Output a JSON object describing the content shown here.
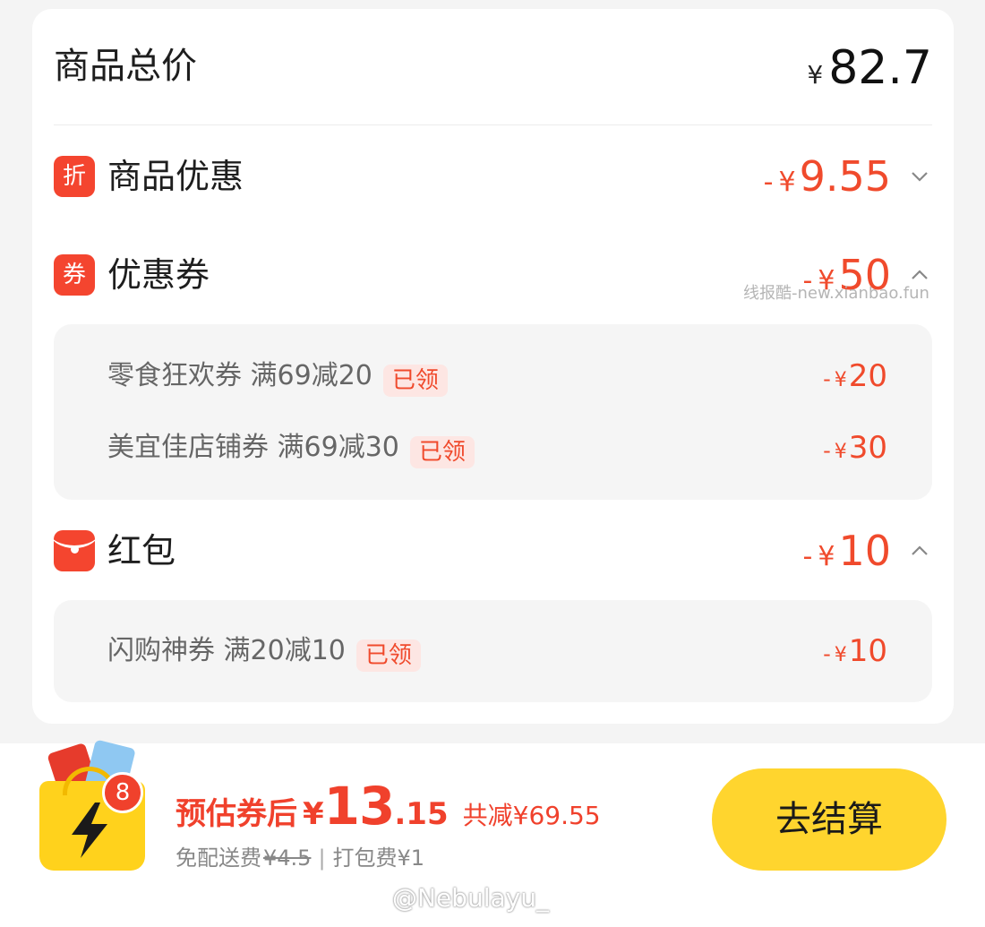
{
  "summary": {
    "total_label": "商品总价",
    "total_currency": "¥",
    "total_value": "82.7"
  },
  "sections": {
    "product_discount": {
      "badge": "折",
      "title": "商品优惠",
      "sign": "-",
      "currency": "¥",
      "amount": "9.55",
      "state": "collapsed"
    },
    "coupons": {
      "badge": "券",
      "title": "优惠券",
      "sign": "-",
      "currency": "¥",
      "amount": "50",
      "state": "expanded"
    },
    "red_packet": {
      "title": "红包",
      "sign": "-",
      "currency": "¥",
      "amount": "10",
      "state": "expanded"
    }
  },
  "coupon_items": [
    {
      "name": "零食狂欢券  满69减20",
      "tag": "已领",
      "sign": "-",
      "currency": "¥",
      "amount": "20"
    },
    {
      "name": "美宜佳店铺券  满69减30",
      "tag": "已领",
      "sign": "-",
      "currency": "¥",
      "amount": "30"
    }
  ],
  "red_packet_items": [
    {
      "name": "闪购神券  满20减10",
      "tag": "已领",
      "sign": "-",
      "currency": "¥",
      "amount": "10"
    }
  ],
  "watermark": "线报酷-new.xianbao.fun",
  "footer": {
    "cart_count": "8",
    "estimate_label": "预估券后",
    "currency": "¥",
    "price_int": "13",
    "price_dec": ".15",
    "total_saved": "共减¥69.55",
    "delivery_label": "免配送费",
    "delivery_original": "¥4.5",
    "separator": "|",
    "packing_fee": "打包费¥1",
    "checkout_label": "去结算",
    "credit": "@Nebulayu_"
  },
  "colors": {
    "accent_red": "#f04a2c",
    "checkout_yellow": "#ffd52e",
    "background": "#f4f4f4"
  },
  "icons": {
    "chevron_down": "chevron-down-icon",
    "chevron_up": "chevron-up-icon",
    "cart": "shopping-bag-icon",
    "bolt": "lightning-bolt-icon",
    "red_packet": "red-envelope-icon"
  }
}
